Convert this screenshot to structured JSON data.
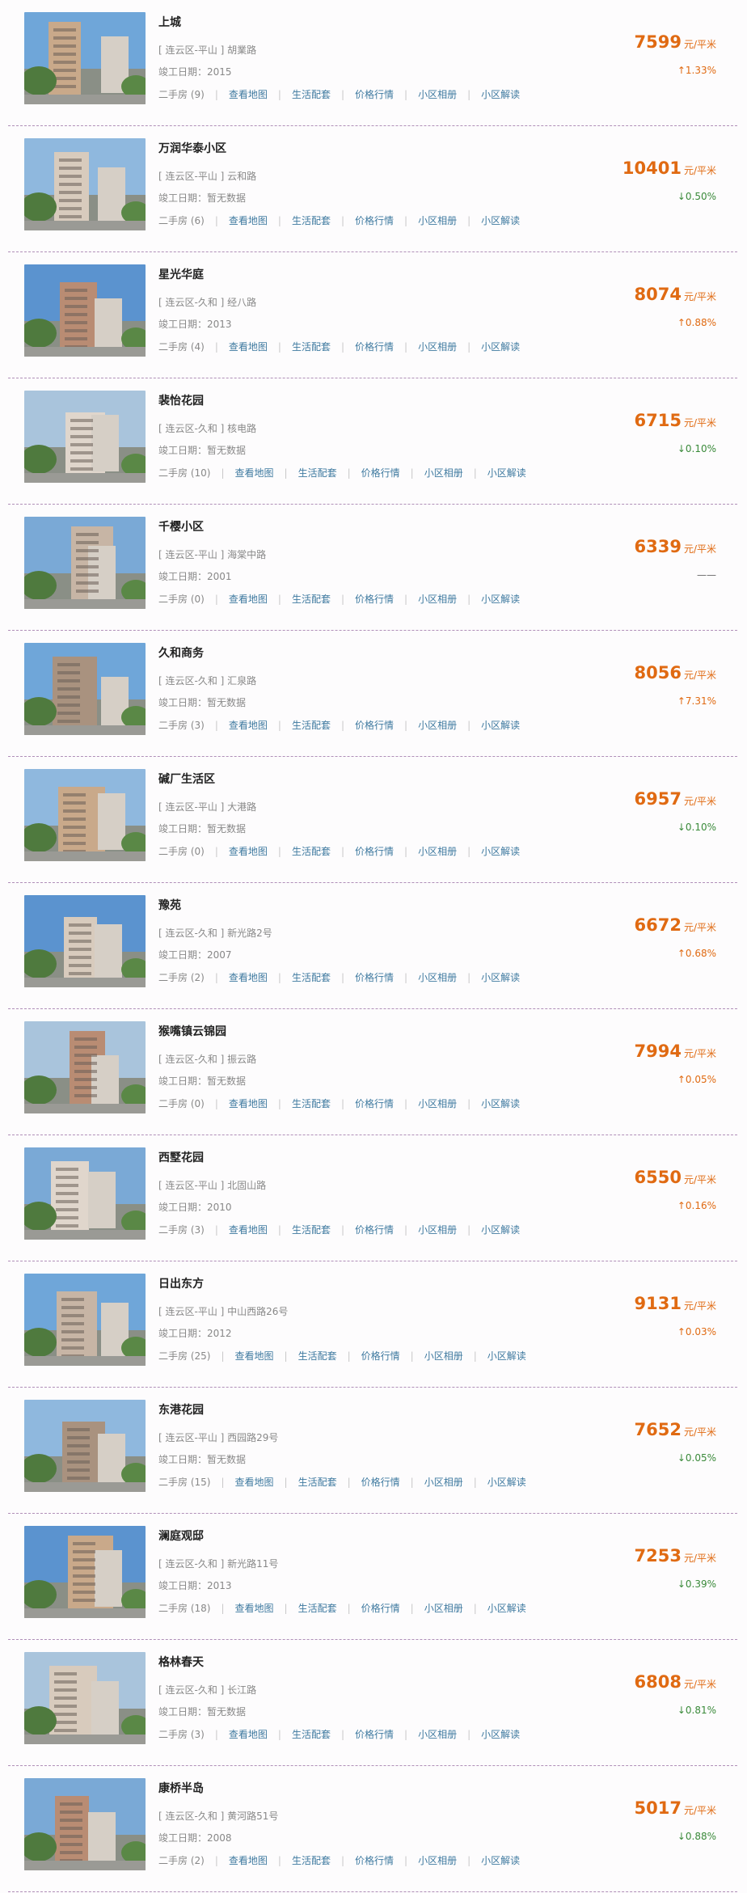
{
  "labels": {
    "completion_prefix": "竣工日期：",
    "second_hand_prefix": "二手房",
    "view_map": "查看地图",
    "life_support": "生活配套",
    "price_trend": "价格行情",
    "album": "小区相册",
    "interpret": "小区解读",
    "unit": "元/平米",
    "no_data": "暂无数据"
  },
  "colors": {
    "price": "#e06a12",
    "down": "#3a8a3a",
    "link": "#3f7aa0",
    "divider": "#b08fb8"
  },
  "listings": [
    {
      "name": "上城",
      "district": "连云区-平山",
      "road": "胡業路",
      "completed": "2015",
      "second_hand": "9",
      "price": "7599",
      "change": "↑1.33%",
      "trend": "up"
    },
    {
      "name": "万润华泰小区",
      "district": "连云区-平山",
      "road": "云和路",
      "completed": "暂无数据",
      "second_hand": "6",
      "price": "10401",
      "change": "↓0.50%",
      "trend": "down"
    },
    {
      "name": "星光华庭",
      "district": "连云区-久和",
      "road": "经八路",
      "completed": "2013",
      "second_hand": "4",
      "price": "8074",
      "change": "↑0.88%",
      "trend": "up"
    },
    {
      "name": "裴怡花园",
      "district": "连云区-久和",
      "road": "核电路",
      "completed": "暂无数据",
      "second_hand": "10",
      "price": "6715",
      "change": "↓0.10%",
      "trend": "down"
    },
    {
      "name": "千樱小区",
      "district": "连云区-平山",
      "road": "海棠中路",
      "completed": "2001",
      "second_hand": "0",
      "price": "6339",
      "change": "——",
      "trend": "flat"
    },
    {
      "name": "久和商务",
      "district": "连云区-久和",
      "road": "汇泉路",
      "completed": "暂无数据",
      "second_hand": "3",
      "price": "8056",
      "change": "↑7.31%",
      "trend": "up"
    },
    {
      "name": "碱厂生活区",
      "district": "连云区-平山",
      "road": "大港路",
      "completed": "暂无数据",
      "second_hand": "0",
      "price": "6957",
      "change": "↓0.10%",
      "trend": "down"
    },
    {
      "name": "豫苑",
      "district": "连云区-久和",
      "road": "新光路2号",
      "completed": "2007",
      "second_hand": "2",
      "price": "6672",
      "change": "↑0.68%",
      "trend": "up"
    },
    {
      "name": "猴嘴镇云锦园",
      "district": "连云区-久和",
      "road": "振云路",
      "completed": "暂无数据",
      "second_hand": "0",
      "price": "7994",
      "change": "↑0.05%",
      "trend": "up"
    },
    {
      "name": "西墅花园",
      "district": "连云区-平山",
      "road": "北固山路",
      "completed": "2010",
      "second_hand": "3",
      "price": "6550",
      "change": "↑0.16%",
      "trend": "up"
    },
    {
      "name": "日出东方",
      "district": "连云区-平山",
      "road": "中山西路26号",
      "completed": "2012",
      "second_hand": "25",
      "price": "9131",
      "change": "↑0.03%",
      "trend": "up"
    },
    {
      "name": "东港花园",
      "district": "连云区-平山",
      "road": "西园路29号",
      "completed": "暂无数据",
      "second_hand": "15",
      "price": "7652",
      "change": "↓0.05%",
      "trend": "down"
    },
    {
      "name": "澜庭观邸",
      "district": "连云区-久和",
      "road": "新光路11号",
      "completed": "2013",
      "second_hand": "18",
      "price": "7253",
      "change": "↓0.39%",
      "trend": "down"
    },
    {
      "name": "格林春天",
      "district": "连云区-久和",
      "road": "长江路",
      "completed": "暂无数据",
      "second_hand": "3",
      "price": "6808",
      "change": "↓0.81%",
      "trend": "down"
    },
    {
      "name": "康桥半岛",
      "district": "连云区-久和",
      "road": "黄河路51号",
      "completed": "2008",
      "second_hand": "2",
      "price": "5017",
      "change": "↓0.88%",
      "trend": "down"
    }
  ]
}
